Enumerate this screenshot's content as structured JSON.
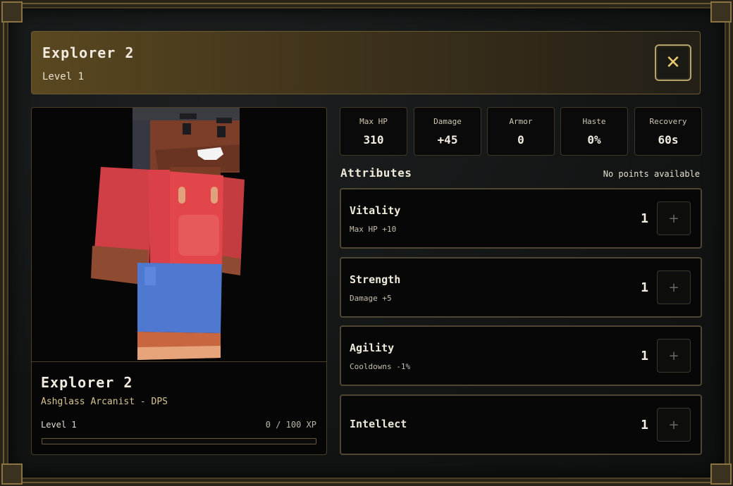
{
  "header": {
    "title": "Explorer 2",
    "subtitle": "Level 1",
    "close_label": "✕"
  },
  "character": {
    "name": "Explorer 2",
    "class_role": "Ashglass Arcanist - DPS",
    "level_label": "Level 1",
    "xp_label": "0 / 100 XP",
    "xp_progress": 0
  },
  "stats": [
    {
      "label": "Max HP",
      "value": "310"
    },
    {
      "label": "Damage",
      "value": "+45"
    },
    {
      "label": "Armor",
      "value": "0"
    },
    {
      "label": "Haste",
      "value": "0%"
    },
    {
      "label": "Recovery",
      "value": "60s"
    }
  ],
  "attributes": {
    "title": "Attributes",
    "points_label": "No points available",
    "items": [
      {
        "name": "Vitality",
        "desc": "Max HP +10",
        "value": "1",
        "plus_label": "+"
      },
      {
        "name": "Strength",
        "desc": "Damage +5",
        "value": "1",
        "plus_label": "+"
      },
      {
        "name": "Agility",
        "desc": "Cooldowns -1%",
        "value": "1",
        "plus_label": "+"
      },
      {
        "name": "Intellect",
        "desc": "",
        "value": "1",
        "plus_label": "+"
      }
    ]
  },
  "colors": {
    "accent_gold": "#c9a24c",
    "header_gold": "#5a4820",
    "shirt_red": "#e2454a",
    "pants_blue": "#4f78d0",
    "skin": "#a9593b"
  },
  "icons": {
    "close": "close-icon",
    "plus": "plus-icon"
  }
}
